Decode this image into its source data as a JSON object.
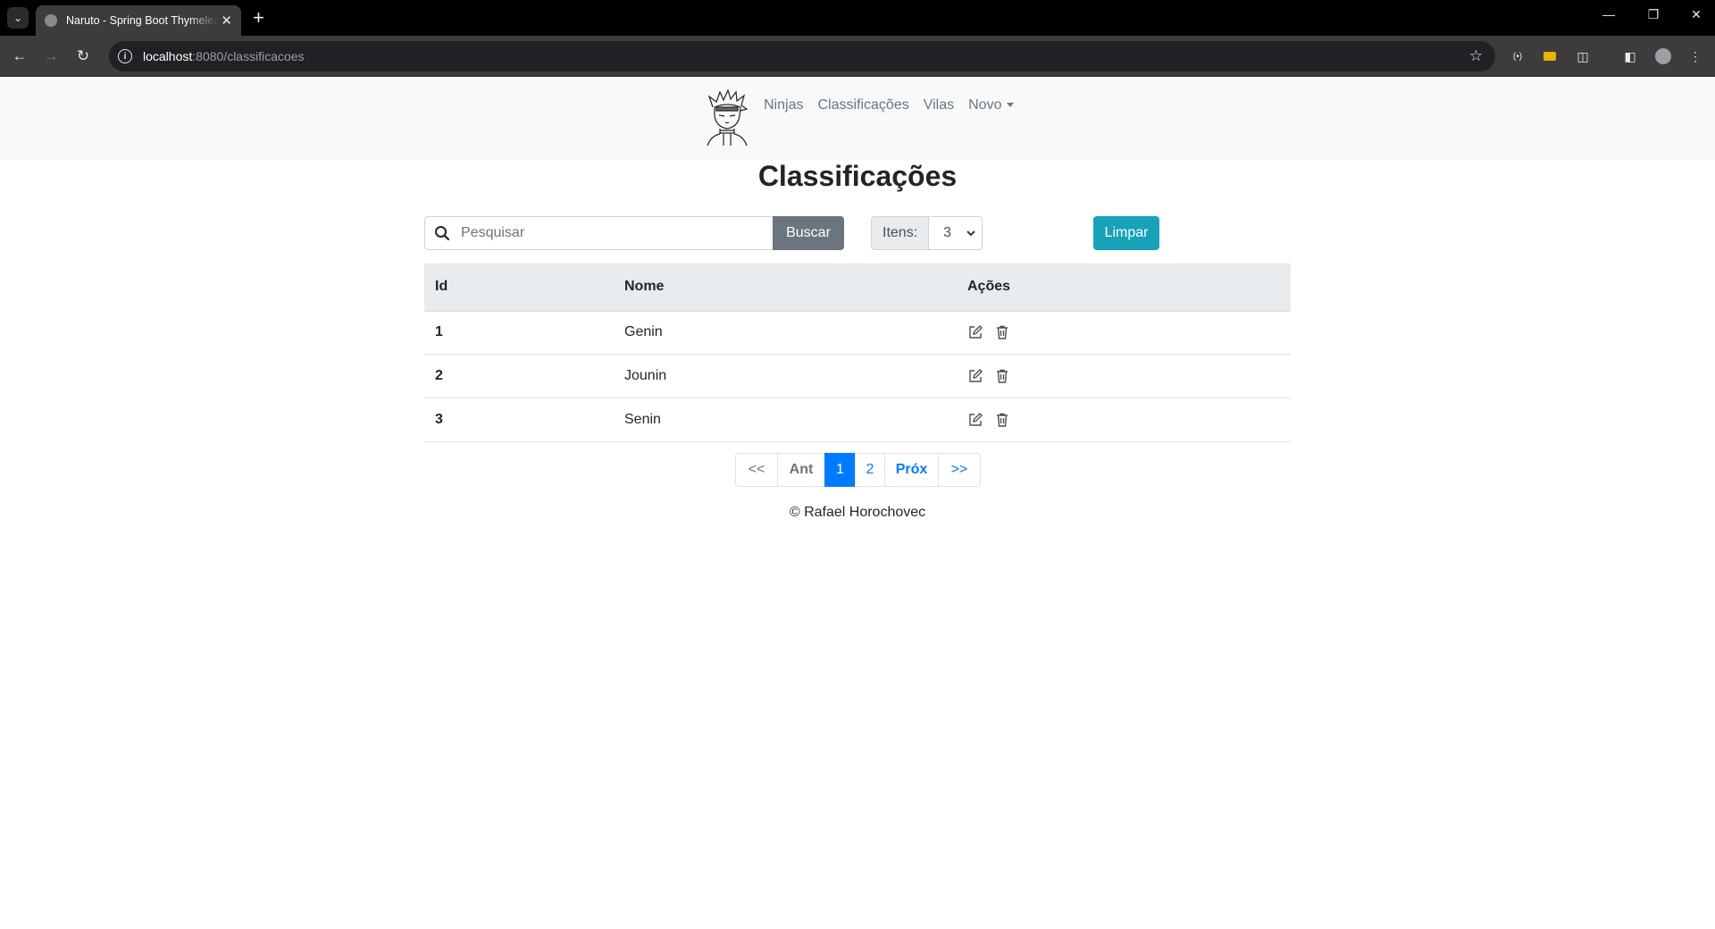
{
  "browser": {
    "tab_title": "Naruto - Spring Boot Thymeleaf",
    "url_host": "localhost",
    "url_rest": ":8080/classificacoes"
  },
  "navbar": {
    "items": [
      {
        "label": "Ninjas"
      },
      {
        "label": "Classificações"
      },
      {
        "label": "Vilas"
      },
      {
        "label": "Novo"
      }
    ]
  },
  "main": {
    "title": "Classificações",
    "search": {
      "placeholder": "Pesquisar",
      "button_label": "Buscar"
    },
    "items_per_page": {
      "label": "Itens:",
      "value": "3"
    },
    "clear_label": "Limpar"
  },
  "table": {
    "headers": [
      "Id",
      "Nome",
      "Ações"
    ],
    "rows": [
      {
        "id": "1",
        "nome": "Genin"
      },
      {
        "id": "2",
        "nome": "Jounin"
      },
      {
        "id": "3",
        "nome": "Senin"
      }
    ]
  },
  "pagination": {
    "first": "<<",
    "prev": "Ant",
    "pages": [
      "1",
      "2"
    ],
    "current": "1",
    "next": "Próx",
    "last": ">>"
  },
  "footer": {
    "text": "© Rafael Horochovec"
  },
  "colors": {
    "navbar_bg": "#f8f9fa",
    "primary": "#007bff",
    "secondary": "#6c757d",
    "info": "#17a2b8"
  }
}
